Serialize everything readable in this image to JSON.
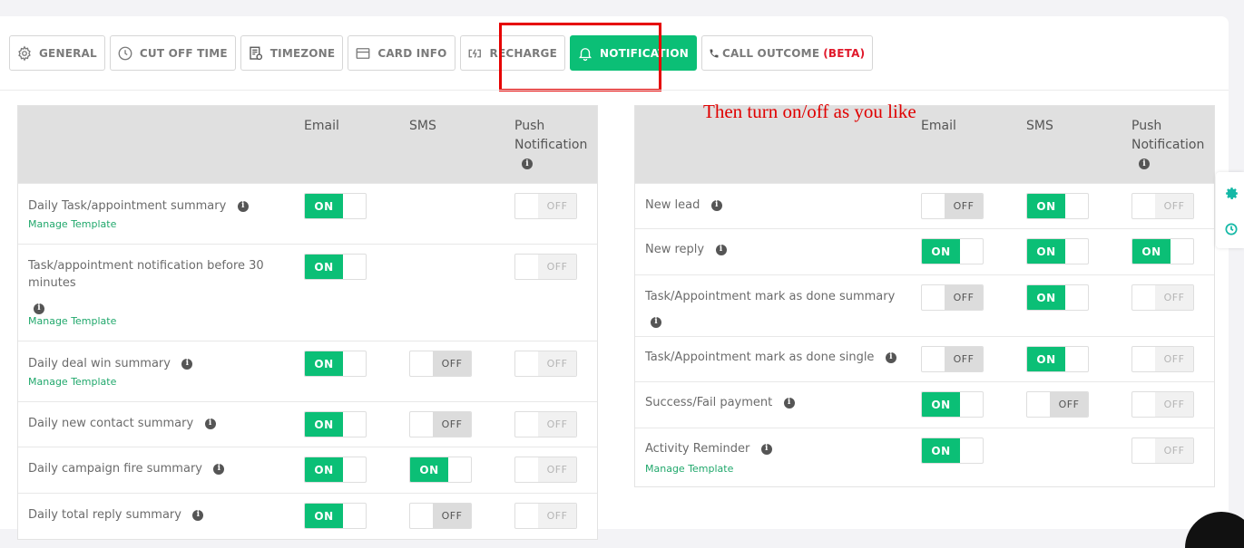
{
  "tabs": [
    {
      "label": "GENERAL",
      "icon": "gear-icon"
    },
    {
      "label": "CUT OFF TIME",
      "icon": "clock-icon"
    },
    {
      "label": "TIMEZONE",
      "icon": "document-icon"
    },
    {
      "label": "CARD INFO",
      "icon": "card-icon"
    },
    {
      "label": "RECHARGE",
      "icon": "battery-charge-icon"
    },
    {
      "label": "NOTIFICATION",
      "icon": "bell-icon",
      "active": true
    },
    {
      "label": "CALL OUTCOME",
      "icon": "phone-icon",
      "badge": "(BETA)"
    }
  ],
  "annotation": "Then turn on/off as you like",
  "columns": {
    "email": "Email",
    "sms": "SMS",
    "push": "Push Notification"
  },
  "toggle": {
    "on": "ON",
    "off": "OFF"
  },
  "manage_template": "Manage Template",
  "left_table": [
    {
      "label": "Daily Task/appointment summary",
      "email": "on",
      "sms": null,
      "push": "off-disabled",
      "manage": true
    },
    {
      "label": "Task/appointment notification before 30 minutes",
      "email": "on",
      "sms": null,
      "push": "off-disabled",
      "manage": true
    },
    {
      "label": "Daily deal win summary",
      "email": "on",
      "sms": "off",
      "push": "off-disabled",
      "manage": true
    },
    {
      "label": "Daily new contact summary",
      "email": "on",
      "sms": "off",
      "push": "off-disabled",
      "manage": false
    },
    {
      "label": "Daily campaign fire summary",
      "email": "on",
      "sms": "on",
      "push": "off-disabled",
      "manage": false
    },
    {
      "label": "Daily total reply summary",
      "email": "on",
      "sms": "off",
      "push": "off-disabled",
      "manage": false
    }
  ],
  "right_table": [
    {
      "label": "New lead",
      "email": "off",
      "sms": "on",
      "push": "off-disabled",
      "manage": false
    },
    {
      "label": "New reply",
      "email": "on",
      "sms": "on",
      "push": "on",
      "manage": false
    },
    {
      "label": "Task/Appointment mark as done summary",
      "email": "off",
      "sms": "on",
      "push": "off-disabled",
      "manage": false
    },
    {
      "label": "Task/Appointment mark as done single",
      "email": "off",
      "sms": "on",
      "push": "off-disabled",
      "manage": false
    },
    {
      "label": "Success/Fail payment",
      "email": "on",
      "sms": "off",
      "push": "off-disabled",
      "manage": false
    },
    {
      "label": "Activity Reminder",
      "email": "on",
      "sms": null,
      "push": "off-disabled",
      "manage": true
    }
  ],
  "colors": {
    "accent": "#0bbf76",
    "highlight": "#e60000",
    "beta": "#e0192b"
  }
}
